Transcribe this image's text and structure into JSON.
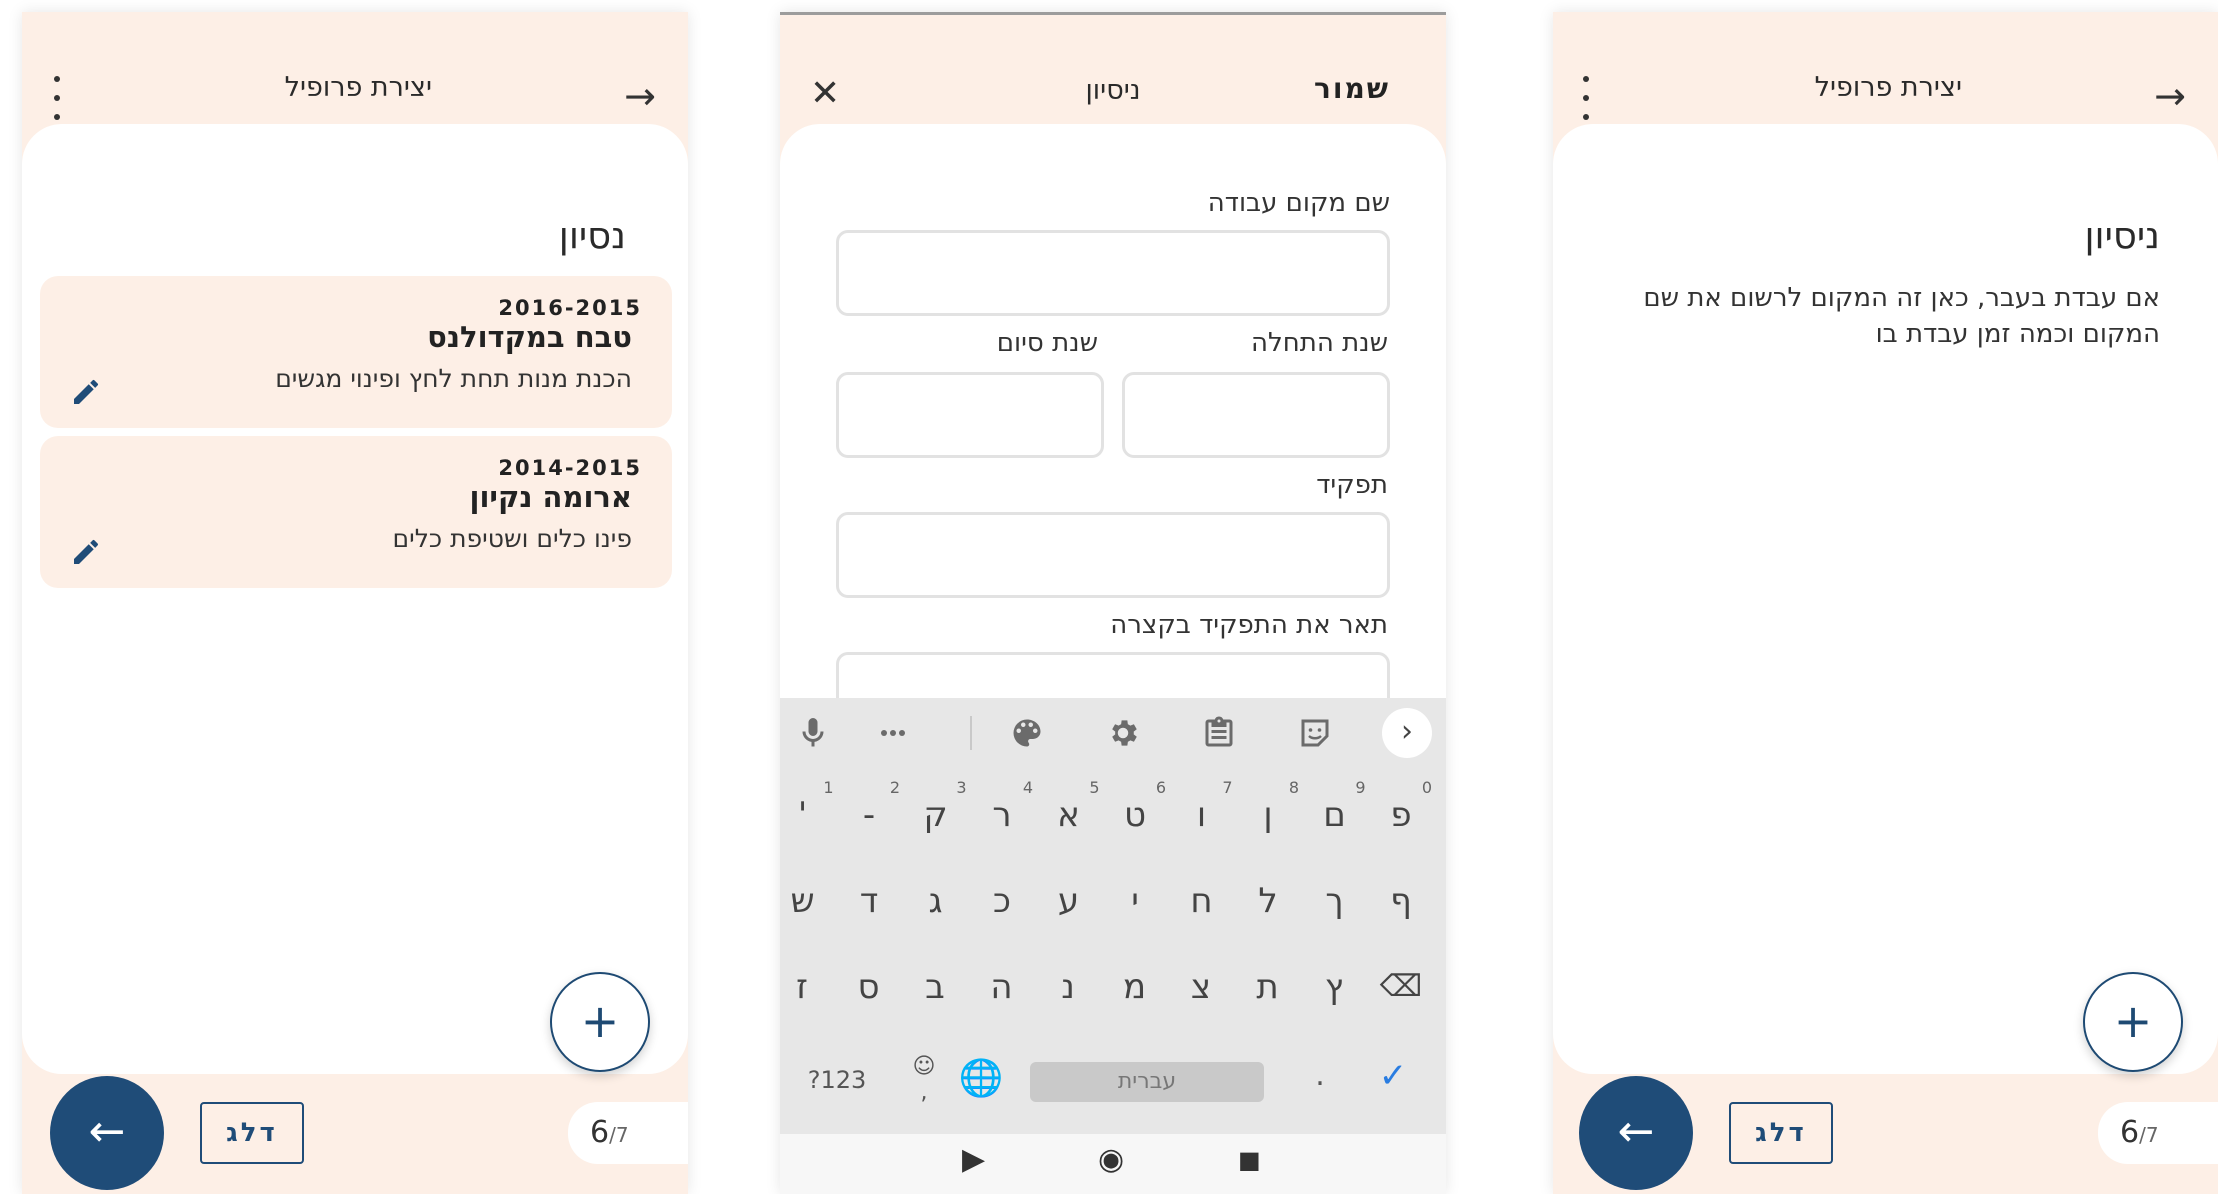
{
  "screen1": {
    "header_title": "יצירת פרופיל",
    "section_title": "נסיון",
    "experiences": [
      {
        "years": "2016-2015",
        "place": "טבח במקדולנס",
        "description": "הכנת מנות תחת לחץ ופינוי מגשים"
      },
      {
        "years": "2014-2015",
        "place": "ארומה נקיון",
        "description": "פינו כלים ושטיפת כלים"
      }
    ],
    "add_symbol": "+",
    "back_symbol": "←",
    "skip_label": "דלג",
    "page_current": "6",
    "page_total": "/7"
  },
  "screen2": {
    "close_symbol": "✕",
    "header_title": "ניסיון",
    "save_label": "שמור",
    "fields": {
      "workplace_label": "שם מקום עבודה",
      "start_year_label": "שנת התחלה",
      "end_year_label": "שנת סיום",
      "role_label": "תפקיד",
      "role_desc_label": "תאר את התפקיד בקצרה"
    },
    "keyboard": {
      "row1": [
        {
          "k": "פ",
          "n": "0"
        },
        {
          "k": "ם",
          "n": "9"
        },
        {
          "k": "ן",
          "n": "8"
        },
        {
          "k": "ו",
          "n": "7"
        },
        {
          "k": "ט",
          "n": "6"
        },
        {
          "k": "א",
          "n": "5"
        },
        {
          "k": "ר",
          "n": "4"
        },
        {
          "k": "ק",
          "n": "3"
        },
        {
          "k": "-",
          "n": "2"
        },
        {
          "k": "'",
          "n": "1"
        }
      ],
      "row2": [
        "ף",
        "ך",
        "ל",
        "ח",
        "י",
        "ע",
        "כ",
        "ג",
        "ד",
        "ש"
      ],
      "row3": [
        "ץ",
        "ת",
        "צ",
        "מ",
        "נ",
        "ה",
        "ב",
        "ס",
        "ז"
      ],
      "symbols_key": "?123",
      "space_label": "עברית",
      "period_key": ".",
      "done_symbol": "✓",
      "comma_key": ","
    },
    "nav": {
      "back": "▶",
      "home": "◉",
      "recents": "■"
    }
  },
  "screen3": {
    "header_title": "יצירת פרופיל",
    "section_title": "ניסיון",
    "intro_text": "אם עבדת בעבר, כאן זה המקום לרשום  את שם המקום וכמה זמן עבדת בו",
    "add_symbol": "+",
    "back_symbol": "←",
    "skip_label": "דלג",
    "page_current": "6",
    "page_total": "/7"
  },
  "colors": {
    "header_bg": "#fdefe6",
    "primary": "#1f4c78",
    "card_bg": "#fdefe6",
    "keyboard_bg": "#e7e7e7",
    "check_blue": "#2a7de1"
  }
}
